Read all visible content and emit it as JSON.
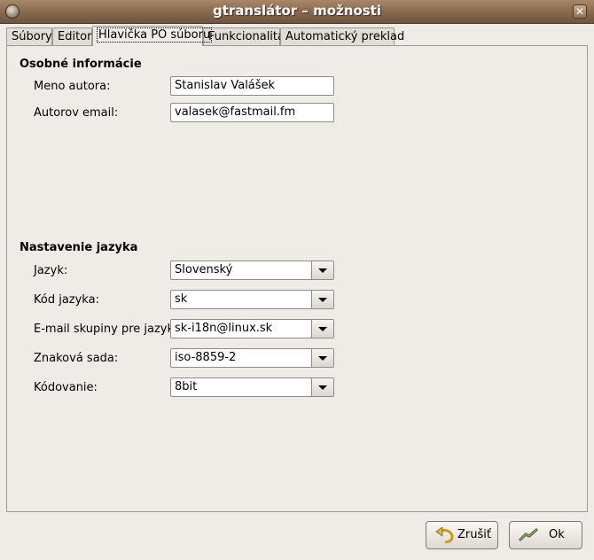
{
  "window": {
    "title": "gtranslátor – možnosti"
  },
  "tabs": [
    {
      "label": "Súbory"
    },
    {
      "label": "Editor"
    },
    {
      "label": "Hlavička PO súboru"
    },
    {
      "label": "Funkcionalita"
    },
    {
      "label": "Automatický preklad"
    }
  ],
  "personal": {
    "title": "Osobné informácie",
    "author_label": "Meno autora:",
    "author_value": "Stanislav Valášek",
    "email_label": "Autorov email:",
    "email_value": "valasek@fastmail.fm"
  },
  "language": {
    "title": "Nastavenie jazyka",
    "fields": [
      {
        "label": "Jazyk:",
        "value": "Slovenský"
      },
      {
        "label": "Kód jazyka:",
        "value": "sk"
      },
      {
        "label": "E-mail skupiny pre jazyk:",
        "value": "sk-i18n@linux.sk"
      },
      {
        "label": "Znaková sada:",
        "value": "iso-8859-2"
      },
      {
        "label": "Kódovanie:",
        "value": "8bit"
      }
    ]
  },
  "buttons": {
    "cancel_label": "Zrušiť",
    "ok_label": "Ok"
  },
  "icons": {
    "window": "gtranslator-icon",
    "close": "close-icon",
    "cancel": "undo-arrow-icon",
    "ok": "ok-hand-icon"
  }
}
